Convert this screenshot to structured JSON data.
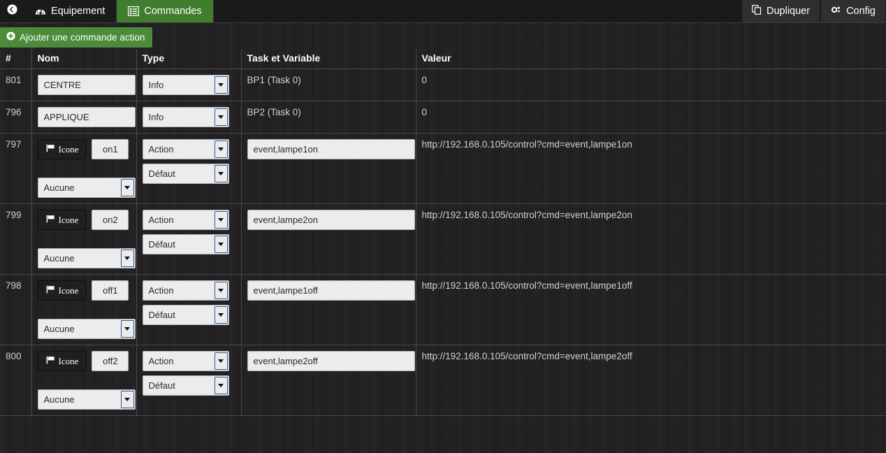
{
  "topbar": {
    "back_icon": "back-arrow-icon",
    "tabs": [
      {
        "label": "Equipement",
        "icon": "dashboard-icon",
        "active": false
      },
      {
        "label": "Commandes",
        "icon": "list-icon",
        "active": true
      }
    ],
    "right_buttons": [
      {
        "label": "Dupliquer",
        "icon": "copy-icon"
      },
      {
        "label": "Config",
        "icon": "gear-icon"
      }
    ]
  },
  "toolbar": {
    "add_label": "Ajouter une commande action",
    "add_icon": "plus-circle-icon",
    "add_color": "#4b8b39"
  },
  "table": {
    "headers": [
      "#",
      "Nom",
      "Type",
      "Task et Variable",
      "Valeur"
    ],
    "rows": [
      {
        "id": "801",
        "has_icon_button": false,
        "nom_value": "CENTRE",
        "type_value": "Info",
        "has_subtype": false,
        "task_is_input": false,
        "task_text": "BP1 (Task 0)",
        "valeur": "0"
      },
      {
        "id": "796",
        "has_icon_button": false,
        "nom_value": "APPLIQUE",
        "type_value": "Info",
        "has_subtype": false,
        "task_is_input": false,
        "task_text": "BP2 (Task 0)",
        "valeur": "0"
      },
      {
        "id": "797",
        "has_icon_button": true,
        "icon_button_label": "Icone",
        "nom_value": "on1",
        "icon_select_value": "Aucune",
        "type_value": "Action",
        "has_subtype": true,
        "subtype_value": "Défaut",
        "task_is_input": true,
        "task_text": "event,lampe1on",
        "valeur": "http://192.168.0.105/control?cmd=event,lampe1on"
      },
      {
        "id": "799",
        "has_icon_button": true,
        "icon_button_label": "Icone",
        "nom_value": "on2",
        "icon_select_value": "Aucune",
        "type_value": "Action",
        "has_subtype": true,
        "subtype_value": "Défaut",
        "task_is_input": true,
        "task_text": "event,lampe2on",
        "valeur": "http://192.168.0.105/control?cmd=event,lampe2on"
      },
      {
        "id": "798",
        "has_icon_button": true,
        "icon_button_label": "Icone",
        "nom_value": "off1",
        "icon_select_value": "Aucune",
        "type_value": "Action",
        "has_subtype": true,
        "subtype_value": "Défaut",
        "task_is_input": true,
        "task_text": "event,lampe1off",
        "valeur": "http://192.168.0.105/control?cmd=event,lampe1off"
      },
      {
        "id": "800",
        "has_icon_button": true,
        "icon_button_label": "Icone",
        "nom_value": "off2",
        "icon_select_value": "Aucune",
        "type_value": "Action",
        "has_subtype": true,
        "subtype_value": "Défaut",
        "task_is_input": true,
        "task_text": "event,lampe2off",
        "valeur": "http://192.168.0.105/control?cmd=event,lampe2off"
      }
    ]
  }
}
